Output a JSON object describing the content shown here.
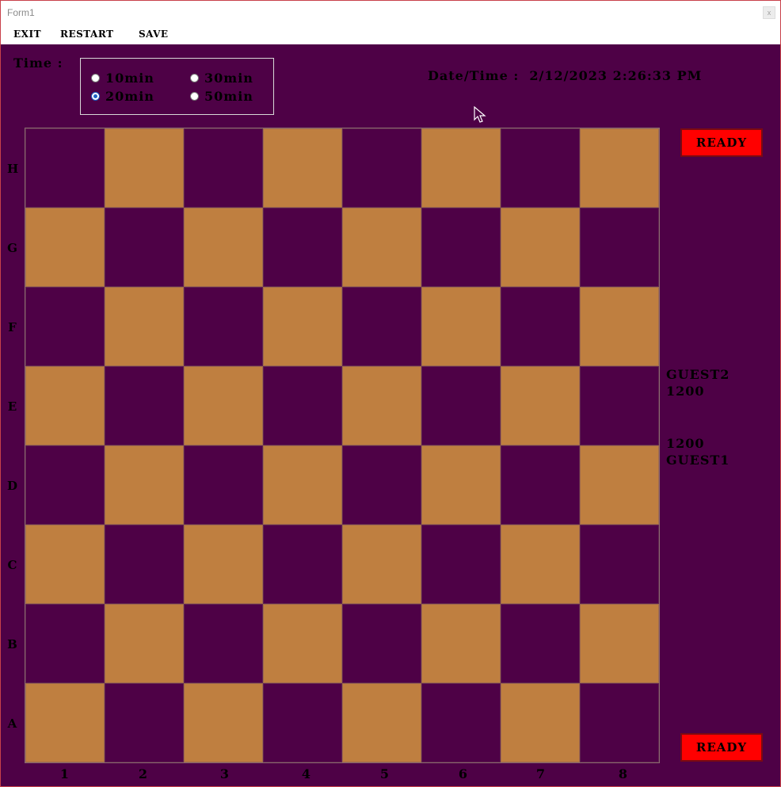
{
  "window": {
    "title": "Form1",
    "close_label": "x"
  },
  "menu": {
    "items": [
      "EXIT",
      "RESTART",
      "SAVE"
    ]
  },
  "time": {
    "label": "Time :",
    "options": [
      {
        "label": "10min",
        "checked": false
      },
      {
        "label": "30min",
        "checked": false
      },
      {
        "label": "20min",
        "checked": true
      },
      {
        "label": "50min",
        "checked": false
      }
    ]
  },
  "datetime": {
    "label": "Date/Time :",
    "value": "2/12/2023 2:26:33 PM"
  },
  "board": {
    "ranks": [
      "H",
      "G",
      "F",
      "E",
      "D",
      "C",
      "B",
      "A"
    ],
    "files": [
      "1",
      "2",
      "3",
      "4",
      "5",
      "6",
      "7",
      "8"
    ],
    "light_color": "#bf7f40",
    "dark_color": "#4e0146"
  },
  "buttons": {
    "ready_top": "READY",
    "ready_bottom": "READY"
  },
  "players": {
    "top": {
      "name": "GUEST2",
      "rating": "1200"
    },
    "bottom": {
      "rating": "1200",
      "name": "GUEST1"
    }
  },
  "colors": {
    "background": "#4e0146",
    "ready_button": "#ff0000"
  }
}
